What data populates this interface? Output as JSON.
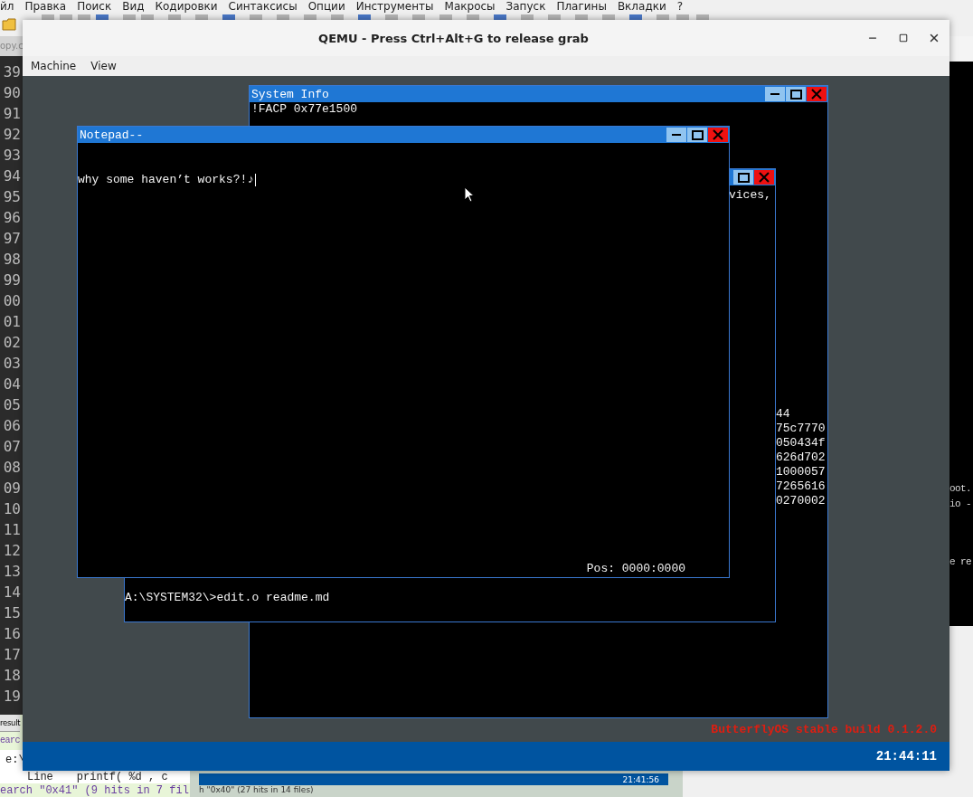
{
  "editor": {
    "menu": [
      "йл",
      "Правка",
      "Поиск",
      "Вид",
      "Кодировки",
      "Синтаксисы",
      "Опции",
      "Инструменты",
      "Макросы",
      "Запуск",
      "Плагины",
      "Вкладки",
      "?"
    ],
    "tab": "opy.c",
    "line_numbers": [
      "39",
      "90",
      "91",
      "92",
      "93",
      "94",
      "95",
      "96",
      "97",
      "98",
      "99",
      "00",
      "01",
      "02",
      "03",
      "04",
      "05",
      "06",
      "07",
      "08",
      "09",
      "10",
      "11",
      "12",
      "13",
      "14",
      "15",
      "16",
      "17",
      "18",
      "19"
    ],
    "side_lines": [
      "oot.",
      "io -",
      "e re"
    ],
    "bottom_tab": "result",
    "search_lines": [
      {
        "kind": "header",
        "text": "earc"
      },
      {
        "kind": "path",
        "text": "e:\\"
      },
      {
        "kind": "hit",
        "label": "Line",
        "code": "printf( %d , c"
      },
      {
        "kind": "summary",
        "text": "earch \"0x41\" (9 hits in 7 fil"
      }
    ]
  },
  "qemu": {
    "title": "QEMU - Press Ctrl+Alt+G to release grab",
    "menu": [
      "Machine",
      "View"
    ],
    "windows": [
      {
        "kind": "sysinfo",
        "title": "System Info",
        "lines": [
          "!FACP 0x77e1500"
        ],
        "tail_lines": [
          "44",
          "75c7770",
          "050434f",
          "626d702",
          "1000057",
          "7265616",
          "0270002"
        ]
      },
      {
        "kind": "console",
        "lines": [
          "vices,"
        ],
        "prompt": "A:\\SYSTEM32\\>edit.o readme.md"
      },
      {
        "kind": "notepad",
        "title": "Notepad--",
        "text": "why some haven’t works?!♪",
        "status": "Pos: 0000:0000"
      }
    ],
    "build_label": "ButterflyOS stable build 0.1.2.0",
    "clock": "21:44:11"
  },
  "thumbnail": {
    "search_text": "h \"0x40\" (27 hits in 14 files)",
    "clock": "21:41:56"
  }
}
